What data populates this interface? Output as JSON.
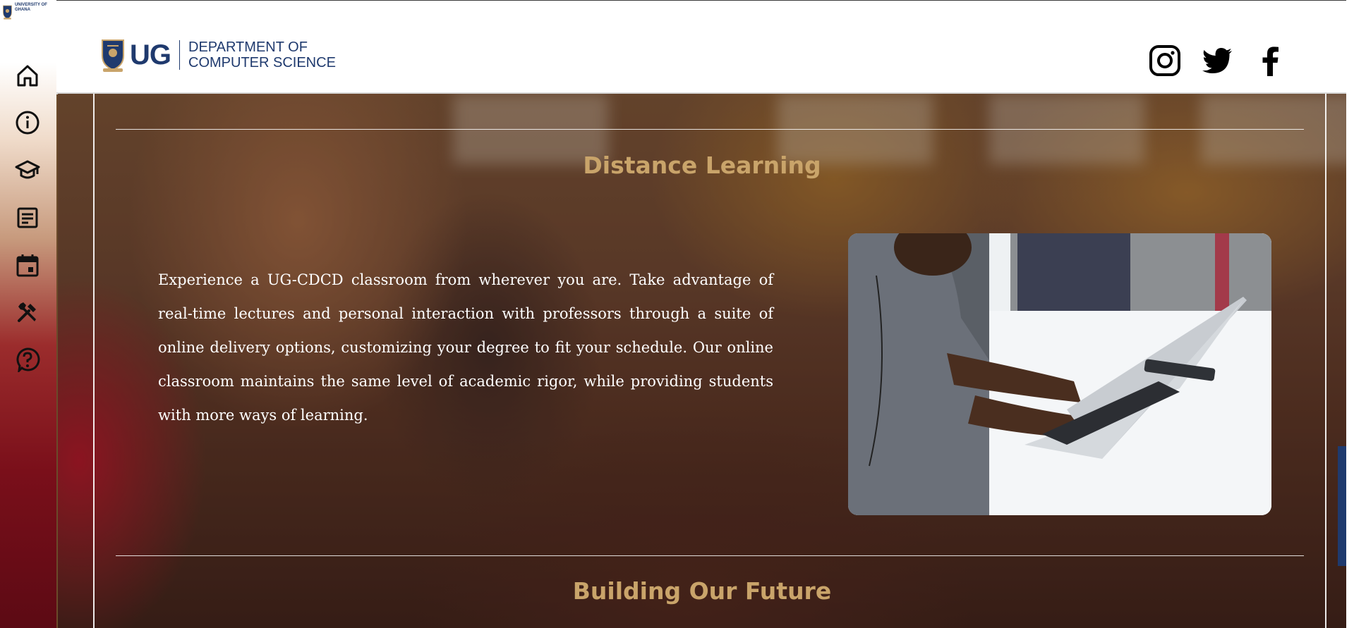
{
  "sidebar": {
    "logo_text": "UNIVERSITY OF GHANA",
    "items": [
      {
        "icon": "home-icon"
      },
      {
        "icon": "info-icon"
      },
      {
        "icon": "graduation-cap-icon"
      },
      {
        "icon": "document-icon"
      },
      {
        "icon": "calendar-icon"
      },
      {
        "icon": "tools-icon"
      },
      {
        "icon": "help-icon"
      }
    ]
  },
  "header": {
    "logo_letters": "UG",
    "dept_line1": "DEPARTMENT OF",
    "dept_line2": "COMPUTER SCIENCE",
    "social": [
      "instagram-icon",
      "twitter-icon",
      "facebook-icon"
    ]
  },
  "main": {
    "section1_title": "Distance Learning",
    "section1_body": "Experience a UG-CDCD classroom from wherever you are. Take advantage of real-time lectures and personal interaction with professors through a suite of online delivery options, customizing your degree to fit your schedule. Our online classroom maintains the same level of academic rigor, while providing students with more ways of learning.",
    "section2_title": "Building Our Future"
  },
  "colors": {
    "brand_blue": "#1f3a6e",
    "title_gold": "#c9a46a"
  }
}
